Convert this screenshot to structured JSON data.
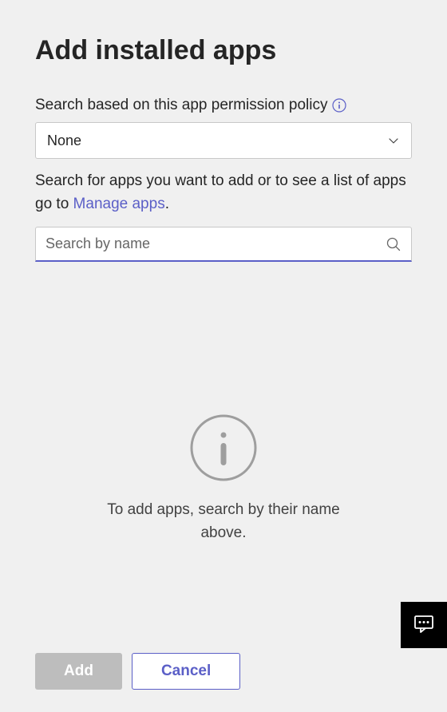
{
  "page": {
    "title": "Add installed apps"
  },
  "policyField": {
    "label": "Search based on this app permission policy",
    "selected": "None"
  },
  "helper": {
    "prefix": "Search for apps you want to add or to see a list of apps go to ",
    "linkText": "Manage apps",
    "suffix": "."
  },
  "search": {
    "placeholder": "Search by name"
  },
  "emptyState": {
    "message": "To add apps, search by their name above."
  },
  "buttons": {
    "add": "Add",
    "cancel": "Cancel"
  }
}
